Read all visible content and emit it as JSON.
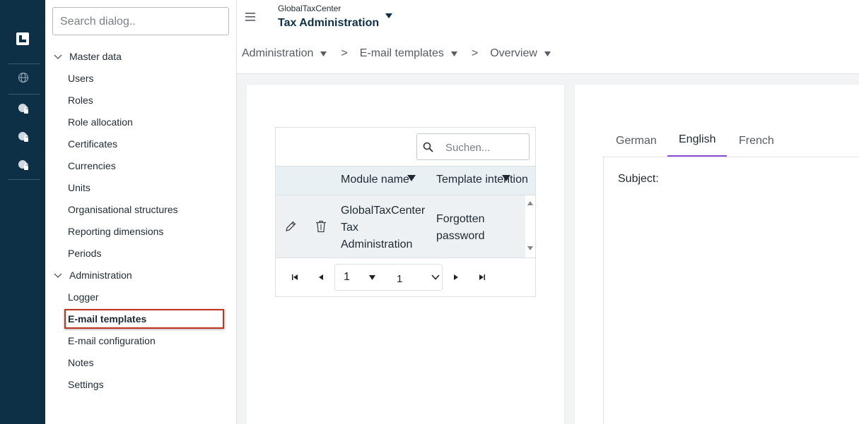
{
  "sidebar": {
    "search_placeholder": "Search dialog..",
    "groups": [
      {
        "label": "Master data",
        "items": [
          "Users",
          "Roles",
          "Role allocation",
          "Certificates",
          "Currencies",
          "Units",
          "Organisational structures",
          "Reporting dimensions",
          "Periods"
        ]
      },
      {
        "label": "Administration",
        "items": [
          "Logger",
          "E-mail templates",
          "E-mail configuration",
          "Notes",
          "Settings"
        ]
      }
    ],
    "active_item": "E-mail templates"
  },
  "header": {
    "app_small": "GlobalTaxCenter",
    "app_title": "Tax Administration",
    "breadcrumb": [
      "Administration",
      "E-mail templates",
      "Overview"
    ],
    "separator": ">"
  },
  "grid": {
    "search_placeholder": "Suchen...",
    "columns": [
      "Module name",
      "Template intention"
    ],
    "rows": [
      {
        "module": "GlobalTaxCenter Tax Administration",
        "intention": "Forgotten password"
      }
    ],
    "pager": {
      "page": "1",
      "total": "1"
    }
  },
  "editor": {
    "tabs": [
      "German",
      "English",
      "French"
    ],
    "active_tab": "English",
    "subject_label": "Subject:"
  },
  "colors": {
    "rail": "#0e3047",
    "highlight": "#c0341d",
    "tab_accent": "#8c4fd6"
  }
}
